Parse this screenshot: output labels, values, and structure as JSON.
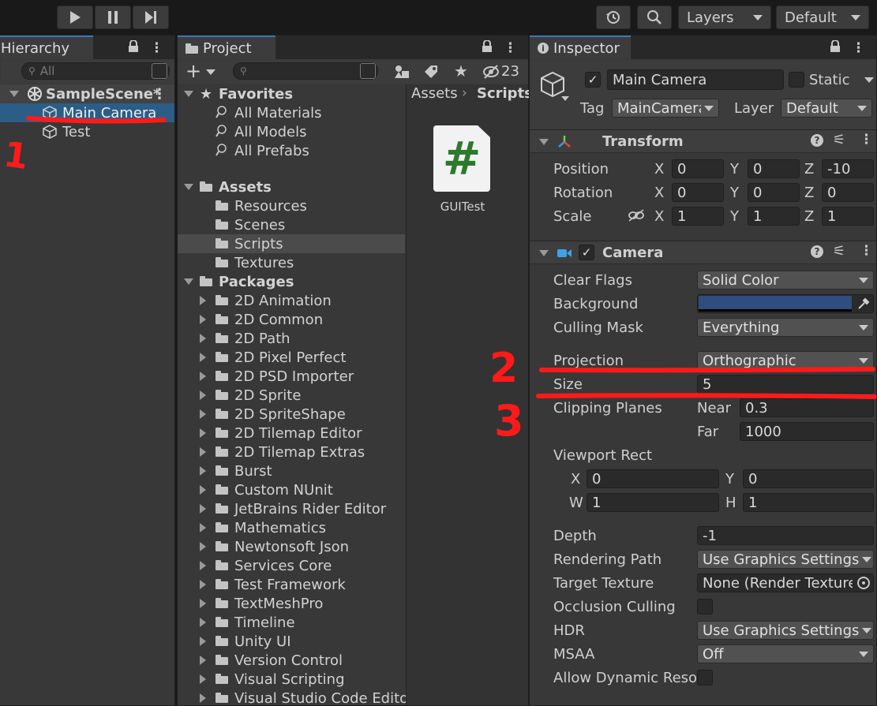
{
  "toolbar": {
    "layers_label": "Layers",
    "layout_label": "Default"
  },
  "hierarchy": {
    "tab": "Hierarchy",
    "search_placeholder": "All",
    "scene": "SampleScene*",
    "items": [
      "Main Camera",
      "Test"
    ]
  },
  "project": {
    "tab": "Project",
    "hidden_count": "23",
    "favorites": {
      "label": "Favorites",
      "items": [
        "All Materials",
        "All Models",
        "All Prefabs"
      ]
    },
    "assets": {
      "label": "Assets",
      "items": [
        "Resources",
        "Scenes",
        "Scripts",
        "Textures"
      ]
    },
    "packages": {
      "label": "Packages",
      "items": [
        "2D Animation",
        "2D Common",
        "2D Path",
        "2D Pixel Perfect",
        "2D PSD Importer",
        "2D Sprite",
        "2D SpriteShape",
        "2D Tilemap Editor",
        "2D Tilemap Extras",
        "Burst",
        "Custom NUnit",
        "JetBrains Rider Editor",
        "Mathematics",
        "Newtonsoft Json",
        "Services Core",
        "Test Framework",
        "TextMeshPro",
        "Timeline",
        "Unity UI",
        "Version Control",
        "Visual Scripting",
        "Visual Studio Code Edito"
      ]
    },
    "breadcrumb": [
      "Assets",
      "Scripts"
    ],
    "file": {
      "name": "GUITest",
      "glyph": "#"
    }
  },
  "inspector": {
    "tab": "Inspector",
    "object_name": "Main Camera",
    "static_label": "Static",
    "tag_label": "Tag",
    "tag_value": "MainCamera",
    "layer_label": "Layer",
    "layer_value": "Default",
    "transform": {
      "title": "Transform",
      "position_label": "Position",
      "rotation_label": "Rotation",
      "scale_label": "Scale",
      "position": [
        "0",
        "0",
        "-10"
      ],
      "rotation": [
        "0",
        "0",
        "0"
      ],
      "scale": [
        "1",
        "1",
        "1"
      ]
    },
    "camera": {
      "title": "Camera",
      "clear_flags_label": "Clear Flags",
      "clear_flags": "Solid Color",
      "background_label": "Background",
      "background_color": "#2f4d7e",
      "culling_mask_label": "Culling Mask",
      "culling_mask": "Everything",
      "projection_label": "Projection",
      "projection": "Orthographic",
      "size_label": "Size",
      "size": "5",
      "clipping_label": "Clipping Planes",
      "near_label": "Near",
      "near": "0.3",
      "far_label": "Far",
      "far": "1000",
      "viewport_label": "Viewport Rect",
      "viewport": {
        "x": "0",
        "y": "0",
        "w": "1",
        "h": "1"
      },
      "depth_label": "Depth",
      "depth": "-1",
      "rendering_path_label": "Rendering Path",
      "rendering_path": "Use Graphics Settings",
      "target_texture_label": "Target Texture",
      "target_texture": "None (Render Texture",
      "occlusion_label": "Occlusion Culling",
      "hdr_label": "HDR",
      "hdr": "Use Graphics Settings",
      "msaa_label": "MSAA",
      "msaa": "Off",
      "dynamic_label": "Allow Dynamic Reso"
    }
  },
  "axis_labels": {
    "x": "X",
    "y": "Y",
    "z": "Z",
    "w": "W",
    "h": "H"
  },
  "annotations": [
    "1",
    "2",
    "3"
  ],
  "annotation_color": "#ff1a1a"
}
